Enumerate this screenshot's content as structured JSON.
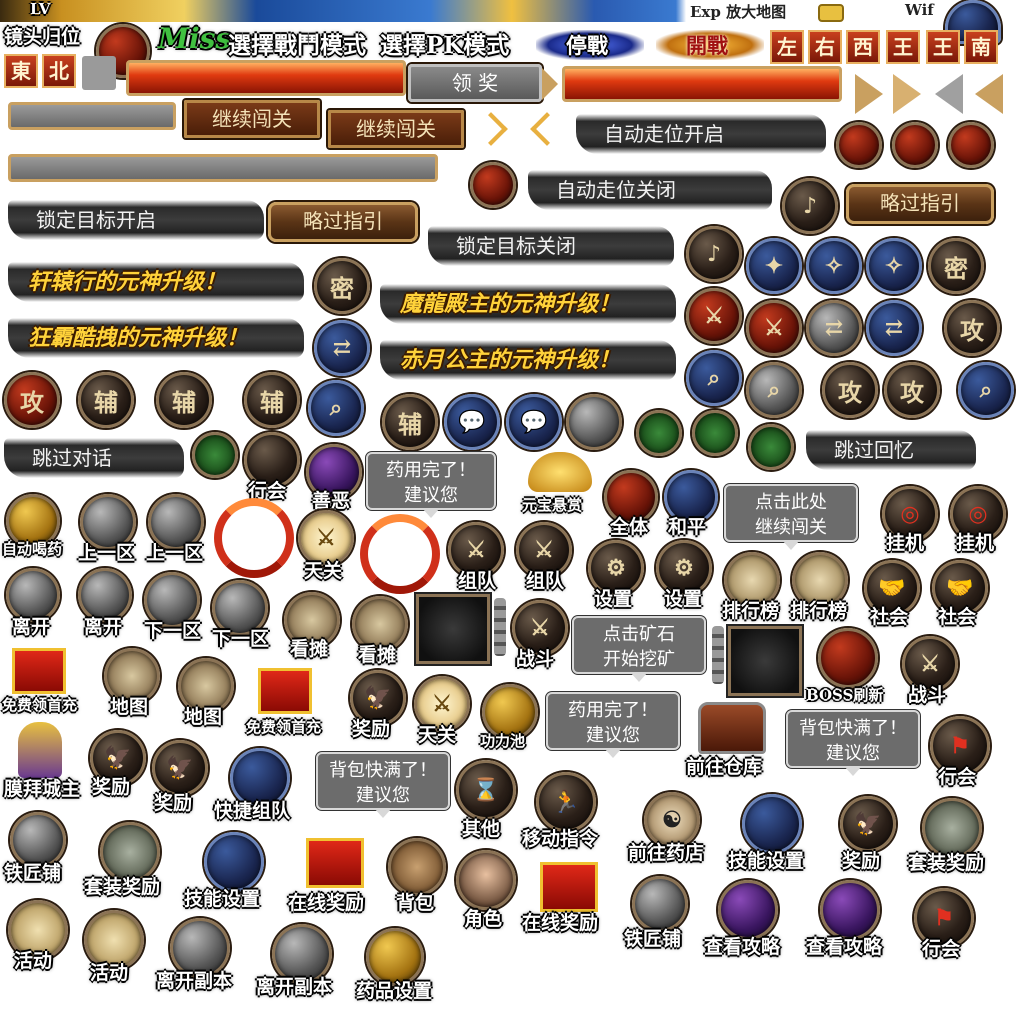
{
  "top_strip": {
    "lv": "LV",
    "exp_map": "Exp 放大地图",
    "wif": "Wif"
  },
  "header": {
    "camera_reset": "镜头归位",
    "miss": "Miss",
    "battle_mode": "選擇戰鬥模式",
    "pk_mode": "選擇PK模式",
    "cease_fire": "停戰",
    "open_fire": "開戰",
    "direction_tiles": [
      "左",
      "右",
      "西",
      "王",
      "王",
      "南"
    ],
    "east_north": [
      "東",
      "北"
    ],
    "claim_reward": "领 奖"
  },
  "buttons": {
    "continue_1": "继续闯关",
    "continue_2": "继续闯关",
    "skip_guide_1": "略过指引",
    "skip_guide_2": "略过指引"
  },
  "banners": {
    "auto_walk_on": "自动走位开启",
    "auto_walk_off": "自动走位关闭",
    "lock_on": "锁定目标开启",
    "lock_off": "锁定目标关闭",
    "skip_dialog": "跳过对话",
    "skip_memory": "跳过回忆"
  },
  "yellow_banners": {
    "b1": "轩辕行的元神升级！",
    "b2": "狂霸酷拽的元神升级！",
    "b3": "魔龍殿主的元神升级！",
    "b4": "赤月公主的元神升级！"
  },
  "glyphs": {
    "secret": "密",
    "attack": "攻",
    "assist": "辅"
  },
  "tips": {
    "med_out_1": [
      "药用完了！",
      "建议您"
    ],
    "click_continue": [
      "点击此处",
      "继续闯关"
    ],
    "click_mine": [
      "点击矿石",
      "开始挖矿"
    ],
    "med_out_2": [
      "药用完了！",
      "建议您"
    ],
    "bag_full_1": [
      "背包快满了！",
      "建议您"
    ],
    "bag_full_2": [
      "背包快满了！",
      "建议您"
    ]
  },
  "labels": {
    "guild": "行会",
    "good_evil": "善恶",
    "gold_bounty": "元宝悬赏",
    "all": "全体",
    "peace": "和平",
    "hang": "挂机",
    "auto_potion": "自动喝药",
    "prev_zone": "上一区",
    "sky_gate": "天关",
    "team": "组队",
    "settings": "设置",
    "ranking": "排行榜",
    "social": "社会",
    "leave": "离开",
    "next_zone": "下一区",
    "stall": "看摊",
    "fight": "战斗",
    "free_first_charge": "免费领首充",
    "map": "地图",
    "reward": "奖励",
    "gongli_pool": "功力池",
    "go_warehouse": "前往仓库",
    "boss_refresh": "BOSS刷新",
    "worship_lord": "膜拜城主",
    "quick_team": "快捷组队",
    "other": "其他",
    "move_cmd": "移动指令",
    "go_pharmacy": "前往药店",
    "skill_settings": "技能设置",
    "set_reward": "套装奖励",
    "blacksmith": "铁匠铺",
    "online_reward": "在线奖励",
    "backpack": "背包",
    "character": "角色",
    "view_guide": "查看攻略",
    "activity": "活动",
    "leave_dungeon": "离开副本",
    "potion_settings": "药品设置"
  }
}
